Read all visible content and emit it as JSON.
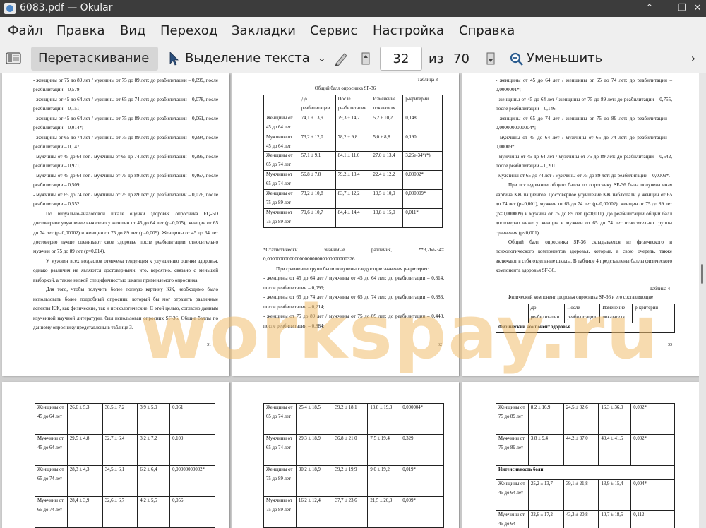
{
  "window": {
    "title": "6083.pdf  — Okular"
  },
  "menu": [
    "Файл",
    "Правка",
    "Вид",
    "Переход",
    "Закладки",
    "Сервис",
    "Настройка",
    "Справка"
  ],
  "toolbar": {
    "drag_label": "Перетаскивание",
    "select_label": "Выделение текста",
    "page_value": "32",
    "of_label": "из",
    "total_pages": "70",
    "zoom_label": "Уменьшить"
  },
  "watermark": "workspay.ru",
  "pages": {
    "p1": {
      "paragraphs": [
        "- женщины от 75 до 89 лет / мужчины от 75 до 89 лет: до реабилитации – 0,099, после реабилитации – 0,579;",
        "- женщины от 45 до 64 лет / мужчины от 65 до 74 лет: до реабилитации – 0,078, после реабилитации – 0,151;",
        "- женщины от 45 до 64 лет / мужчины от 75 до 89 лет: до реабилитации – 0,061, после реабилитации – 0,014*;",
        "- женщины от 65 до 74 лет / мужчины от 75 до 89 лет: до реабилитации – 0,694, после реабилитации – 0,147;",
        "- мужчины от 45 до 64 лет / мужчины от 65 до 74 лет: до реабилитации – 0,395, после реабилитации – 0,971;",
        "- мужчины от 45 до 64 лет / мужчины от 75 до 89 лет: до реабилитации – 0,467, после реабилитации – 0,509;",
        "- мужчины от 65 до 74 лет / мужчины от 75 до 89 лет: до реабилитации – 0,076, после реабилитации – 0,552.",
        "По визуально-аналоговой шкале оценки здоровья опросника EQ-5D достоверное улучшение выявлено у женщин от 45 до 64 лет (p=0,005), женщин от 65 до 74 лет (p=0,00002) и женщин от 75 до 89 лет (p=0,009). Женщины от 45 до 64 лет достоверно лучше оценивают свое здоровье после реабилитации относительно мужчин от 75 до 89 лет (p=0,014).",
        "У мужчин всех возрастов отмечена тенденция к улучшению оценки здоровья, однако различия не являются достоверными, что, вероятно, связано с меньшей выборкой, а также низкой специфичностью шкалы применяемого опросника.",
        "Для того, чтобы получить более полную картину КЖ, необходимо было использовать более подробный опросник, который бы мог отразить различные аспекты КЖ, как физические, так и психологические. С этой целью, согласно данным изученной научной литературы, был использован опросник SF-36. Общие баллы по данному опроснику представлены в таблице 3."
      ],
      "page_number": "31"
    },
    "p2": {
      "table_label": "Таблица 3",
      "table_title": "Общий балл опросника SF-36",
      "headers": [
        "",
        "До реабилитации",
        "После реабилитации",
        "Изменение показателя",
        "р-критерий"
      ],
      "rows": [
        [
          "Женщины от 45 до 64 лет",
          "74,1 ± 13,9",
          "79,3 ± 14,2",
          "5,2 ± 10,2",
          "0,148"
        ],
        [
          "Мужчины от 45 до 64 лет",
          "73,2 ± 12,0",
          "78,2 ± 9,8",
          "5,0 ± 8,8",
          "0,190"
        ],
        [
          "Женщины от 65 до 74 лет",
          "57,1 ± 9,1",
          "84,1 ± 11,6",
          "27,0 ± 13,4",
          "3,26е-34*(*)"
        ],
        [
          "Мужчины от 65 до 74 лет",
          "56,8 ± 7,8",
          "79,2 ± 13,4",
          "22,4 ± 12,2",
          "0,00002*"
        ],
        [
          "Женщины от 75 до 89 лет",
          "73,2 ± 10,8",
          "83,7 ± 12,2",
          "10,5 ± 10,9",
          "0,000009*"
        ],
        [
          "Мужчины от 75 до 89 лет",
          "70,6 ± 10,7",
          "84,4 ± 14,4",
          "13,8 ± 15,0",
          "0,011*"
        ]
      ],
      "note": "*Статистически значимые различия, **3,26е-34= 0,00000000000000000000000000000000326",
      "paragraphs": [
        "При сравнении групп были получены следующие значения р-критерия:",
        "- женщины от 45 до 64 лет / мужчины от 45 до 64 лет: до реабилитации – 0,814, после реабилитации – 0,096;",
        "- женщины от 65 до 74 лет / мужчины от 65 до 74 лет: до реабилитации – 0,883, после реабилитации – 0,214;",
        "- женщины от 75 до 89 лет / мужчины от 75 до 89 лет: до реабилитации – 0,448, после реабилитации – 0,884;"
      ],
      "page_number": "32"
    },
    "p3": {
      "paragraphs": [
        "- женщины от 45 до 64 лет / женщины от 65 до 74 лет: до реабилитации – 0,0000001*;",
        "- женщины от 45 до 64 лет / женщины от 75 до 89 лет: до реабилитации – 0,755, после реабилитации – 0,146;",
        "- женщины от 65 до 74 лет / женщины от 75 до 89 лет: до реабилитации – 0,0000000000004*;",
        "- мужчины от 45 до 64 лет / мужчины от 65 до 74 лет: до реабилитации – 0,00009*;",
        "- мужчины от 45 до 64 лет / мужчины от 75 до 89 лет: до реабилитации – 0,542, после реабилитации – 0,201;",
        "- мужчины от 65 до 74 лет / мужчины от 75 до 89 лет: до реабилитации – 0,0009*.",
        "При исследовании общего балла по опроснику SF-36 была получена иная картина КЖ пациентов. Достоверное улучшение КЖ наблюдали у женщин от 65 до 74 лет (p<0,001), мужчин от 65 до 74 лет (p=0,00002), женщин от 75 до 89 лет (p=0,000009) и мужчин от 75 до 89 лет (p=0,011). До реабилитации общий балл достоверно ниже у женщин и мужчин от 65 до 74 лет относительно группы сравнения (p<0,001).",
        "Общий балл опросника SF-36 складывается из физического и психологического компонентов здоровья, которые, в свою очередь, также включают в себя отдельные шкалы. В таблице 4 представлены баллы физического компонента здоровья SF-36."
      ],
      "table_label": "Таблица 4",
      "table_title": "Физический компонент здоровья опросника SF-36 и его составляющие",
      "headers": [
        "",
        "До реабилитации",
        "После реабилитации",
        "Изменение показателя",
        "р-критерий"
      ],
      "section_row": "Физический компонент здоровья",
      "page_number": "33"
    },
    "p4": {
      "rows": [
        [
          "Женщины от 45 до 64 лет",
          "26,6 ± 5,3",
          "30,5 ± 7,2",
          "3,9 ± 5,9",
          "0,061"
        ],
        [
          "Мужчины от 45 до 64 лет",
          "29,5 ± 4,8",
          "32,7 ± 6,4",
          "3,2 ± 7,2",
          "0,109"
        ],
        [
          "Женщины от 65 до 74 лет",
          "28,3 ± 4,3",
          "34,5 ± 6,1",
          "6,2 ± 6,4",
          "0,00000000002*"
        ],
        [
          "Мужчины от 65 до 74 лет",
          "28,4 ± 3,9",
          "32,6 ± 6,7",
          "4,2 ± 5,5",
          "0,056"
        ]
      ]
    },
    "p5": {
      "rows": [
        [
          "Женщины от 65 до 74 лет",
          "25,4 ± 18,5",
          "39,2 ± 18,1",
          "13,8 ± 19,3",
          "0,000004*"
        ],
        [
          "Мужчины от 65 до 74 лет",
          "29,3 ± 18,9",
          "36,8 ± 21,0",
          "7,5 ± 19,4",
          "0,329"
        ],
        [
          "Женщины от 75 до 89 лет",
          "30,2 ± 18,9",
          "39,2 ± 19,9",
          "9,0 ± 19,2",
          "0,019*"
        ],
        [
          "Мужчины от 75 до 89 лет",
          "16,2 ± 12,4",
          "37,7 ± 23,6",
          "21,5 ± 20,3",
          "0,009*"
        ]
      ]
    },
    "p6": {
      "rows_top": [
        [
          "Женщины от 75 до 89 лет",
          "8,2 ± 16,9",
          "24,5 ± 32,6",
          "16,3 ± 36,0",
          "0,002*"
        ],
        [
          "Мужчины от 75 до 89 лет",
          "3,8 ± 9,4",
          "44,2 ± 37,0",
          "40,4 ± 41,5",
          "0,002*"
        ]
      ],
      "section_row": "Интенсивность боли",
      "rows_bottom": [
        [
          "Женщины от 45 до 64 лет",
          "25,2 ± 13,7",
          "39,1 ± 21,8",
          "13,9 ± 15,4",
          "0,004*"
        ],
        [
          "Мужчины от 45 до 64",
          "32,6 ± 17,2",
          "43,3 ± 20,8",
          "10,7 ± 18,5",
          "0,112"
        ]
      ]
    }
  }
}
